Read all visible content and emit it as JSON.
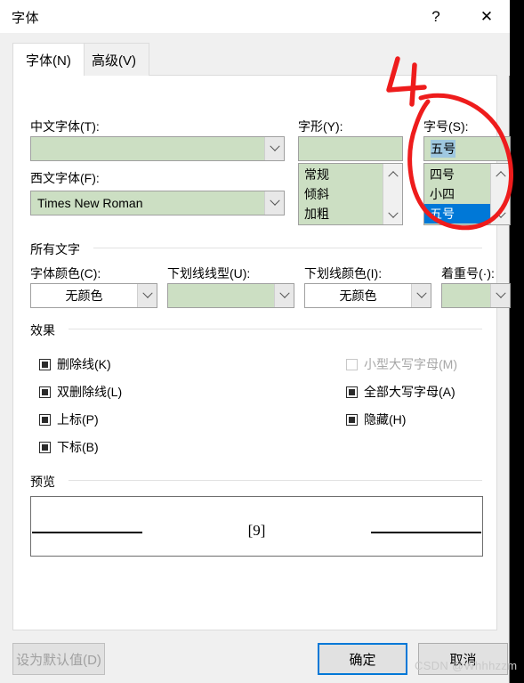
{
  "window": {
    "title": "字体",
    "help_icon": "question-mark-icon",
    "close_icon": "close-icon"
  },
  "tabs": [
    {
      "label": "字体(N)",
      "active": true
    },
    {
      "label": "高级(V)",
      "active": false
    }
  ],
  "font_section": {
    "chinese_font_label": "中文字体(T):",
    "chinese_font_value": "",
    "western_font_label": "西文字体(F):",
    "western_font_value": "Times New Roman",
    "style_label": "字形(Y):",
    "style_value": "",
    "style_options": [
      "常规",
      "倾斜",
      "加粗"
    ],
    "size_label": "字号(S):",
    "size_value": "五号",
    "size_options": [
      "四号",
      "小四",
      "五号"
    ],
    "size_selected": "五号"
  },
  "all_text_section": {
    "group_label": "所有文字",
    "font_color_label": "字体颜色(C):",
    "font_color_value": "无颜色",
    "underline_style_label": "下划线线型(U):",
    "underline_style_value": "",
    "underline_color_label": "下划线颜色(I):",
    "underline_color_value": "无颜色",
    "emphasis_mark_label": "着重号(·):",
    "emphasis_mark_value": ""
  },
  "effects_section": {
    "group_label": "效果",
    "left_items": [
      {
        "label": "删除线(K)",
        "state": "indeterminate",
        "enabled": true
      },
      {
        "label": "双删除线(L)",
        "state": "indeterminate",
        "enabled": true
      },
      {
        "label": "上标(P)",
        "state": "indeterminate",
        "enabled": true
      },
      {
        "label": "下标(B)",
        "state": "indeterminate",
        "enabled": true
      }
    ],
    "right_items": [
      {
        "label": "小型大写字母(M)",
        "state": "unchecked",
        "enabled": false
      },
      {
        "label": "全部大写字母(A)",
        "state": "indeterminate",
        "enabled": true
      },
      {
        "label": "隐藏(H)",
        "state": "indeterminate",
        "enabled": true
      }
    ]
  },
  "preview_section": {
    "group_label": "预览",
    "sample_text": "[9]"
  },
  "buttons": {
    "set_default": "设为默认值(D)",
    "ok": "确定",
    "cancel": "取消"
  },
  "annotation": {
    "number": "4",
    "color": "#ee1c1c",
    "target": "字号(S)"
  },
  "watermark": "CSDN @Whhhzzm",
  "colors": {
    "field_green": "#ccdfc3",
    "selection_blue": "#0078d7",
    "text_highlight": "#9fc8e0",
    "dialog_bg": "#f0f0f0",
    "annotation_red": "#ee1c1c"
  }
}
